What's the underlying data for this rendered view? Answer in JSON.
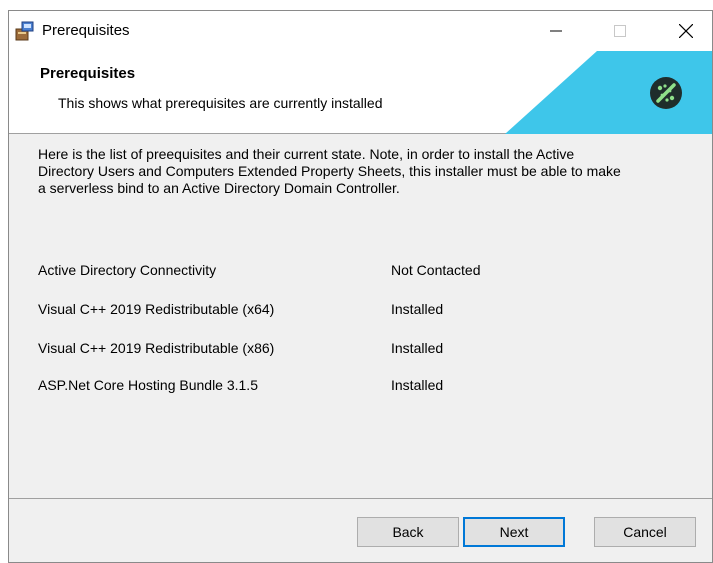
{
  "window": {
    "title": "Prerequisites",
    "controls": {
      "minimize": "minimize",
      "maximize": "maximize",
      "close": "close"
    }
  },
  "banner": {
    "title": "Prerequisites",
    "subtitle": "This shows what prerequisites are currently installed",
    "accent_color": "#3ec6ea",
    "logo_color": "#1f2d2b",
    "logo_mark_color": "#8fe08a"
  },
  "intro_text": "Here is the list of preequisites and their current state. Note, in order to install the Active Directory Users and Computers Extended Property Sheets, this installer must be able to make a serverless bind to an Active Directory Domain Controller.",
  "prerequisites": [
    {
      "name": "Active Directory Connectivity",
      "status": "Not Contacted"
    },
    {
      "name": "Visual C++ 2019 Redistributable (x64)",
      "status": "Installed"
    },
    {
      "name": "Visual C++ 2019 Redistributable (x86)",
      "status": "Installed"
    },
    {
      "name": "ASP.Net Core Hosting Bundle 3.1.5",
      "status": "Installed"
    }
  ],
  "buttons": {
    "back": "Back",
    "next": "Next",
    "cancel": "Cancel"
  }
}
